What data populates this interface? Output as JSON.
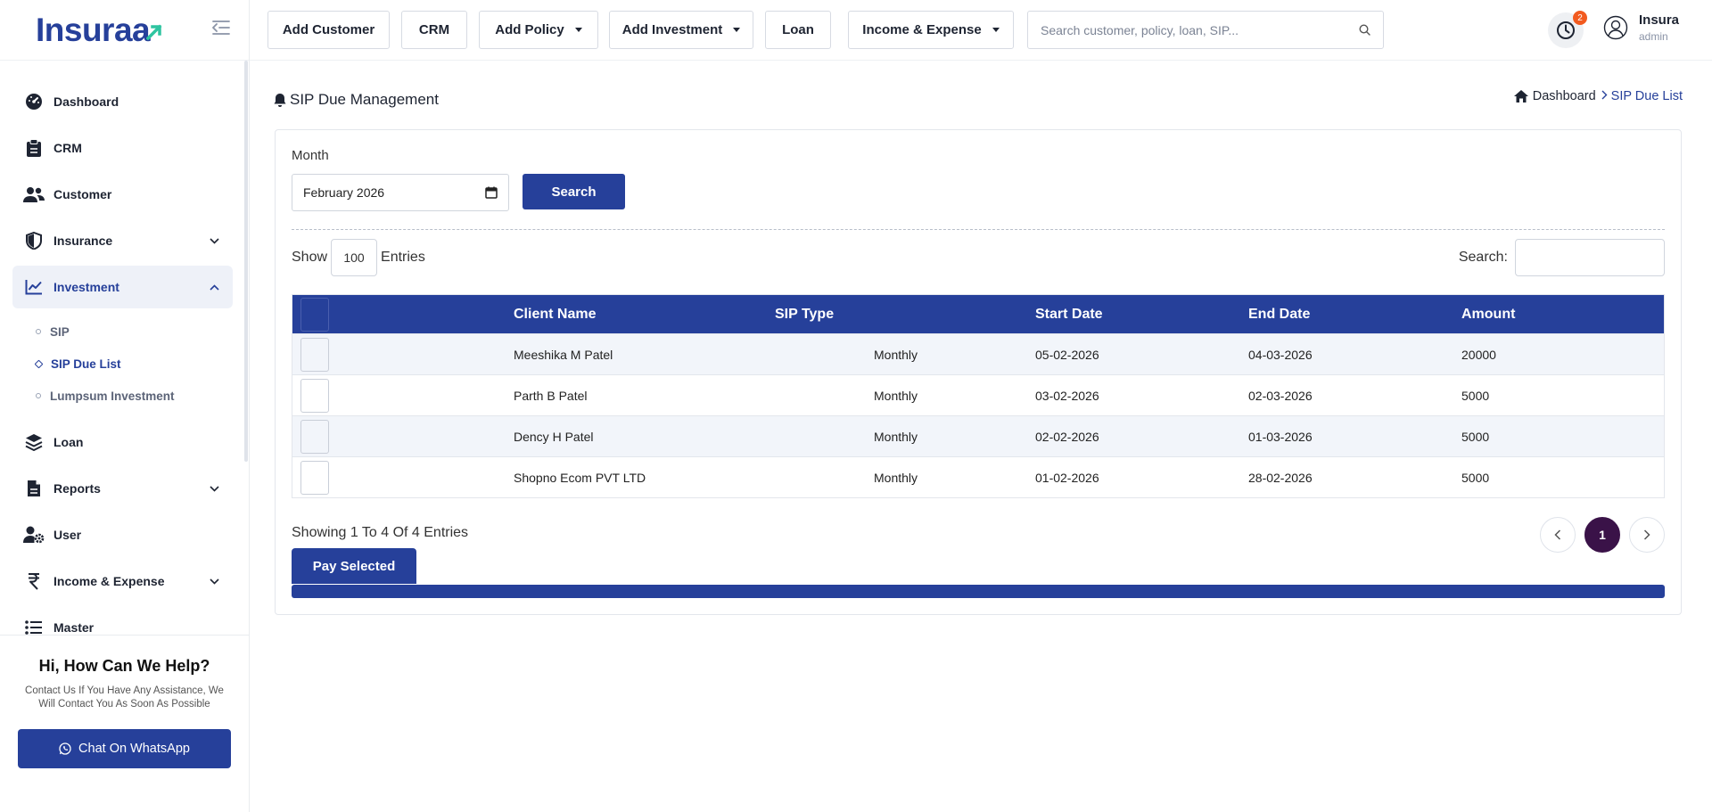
{
  "brand": {
    "name": "Insuraa",
    "accent": "#26409a",
    "logo_green": "#2ec4a0"
  },
  "sidebar": {
    "items": [
      {
        "label": "Dashboard",
        "icon": "gauge-icon"
      },
      {
        "label": "CRM",
        "icon": "clipboard-icon"
      },
      {
        "label": "Customer",
        "icon": "users-icon"
      },
      {
        "label": "Insurance",
        "icon": "shield-icon"
      },
      {
        "label": "Investment",
        "icon": "chart-line-icon"
      },
      {
        "label": "Loan",
        "icon": "layers-icon"
      },
      {
        "label": "Reports",
        "icon": "file-icon"
      },
      {
        "label": "User",
        "icon": "user-gear-icon"
      },
      {
        "label": "Income & Expense",
        "icon": "rupee-icon"
      },
      {
        "label": "Master",
        "icon": "list-icon"
      }
    ],
    "investment_sub": [
      "SIP",
      "SIP Due List",
      "Lumpsum Investment"
    ],
    "help": {
      "title": "Hi, How Can We Help?",
      "text": "Contact Us If You Have Any Assistance, We Will Contact You As Soon As Possible",
      "button": "Chat On WhatsApp"
    }
  },
  "topbar": {
    "buttons": [
      "Add Customer",
      "CRM",
      "Add Policy",
      "Add Investment",
      "Loan",
      "Income & Expense"
    ],
    "search_placeholder": "Search customer, policy, loan, SIP...",
    "notification_count": "2",
    "user": {
      "name": "Insura",
      "role": "admin"
    }
  },
  "page": {
    "title": "SIP Due Management",
    "breadcrumb": {
      "home": "Dashboard",
      "current": "SIP Due List"
    }
  },
  "filters": {
    "month_label": "Month",
    "month_value": "February 2026",
    "search_button": "Search"
  },
  "table_controls": {
    "show_label": "Show",
    "entries_value": "100",
    "entries_label": "Entries",
    "search_label": "Search:"
  },
  "table": {
    "headers": [
      "Client Name",
      "SIP Type",
      "Start Date",
      "End Date",
      "Amount"
    ],
    "rows": [
      {
        "client": "Meeshika M Patel",
        "type": "Monthly",
        "start": "05-02-2026",
        "end": "04-03-2026",
        "amount": "20000"
      },
      {
        "client": "Parth B Patel",
        "type": "Monthly",
        "start": "03-02-2026",
        "end": "02-03-2026",
        "amount": "5000"
      },
      {
        "client": "Dency H Patel",
        "type": "Monthly",
        "start": "02-02-2026",
        "end": "01-03-2026",
        "amount": "5000"
      },
      {
        "client": "Shopno Ecom PVT LTD",
        "type": "Monthly",
        "start": "01-02-2026",
        "end": "28-02-2026",
        "amount": "5000"
      }
    ]
  },
  "footer": {
    "showing": "Showing 1 To 4 Of 4 Entries",
    "current_page": "1",
    "pay_button": "Pay Selected"
  }
}
